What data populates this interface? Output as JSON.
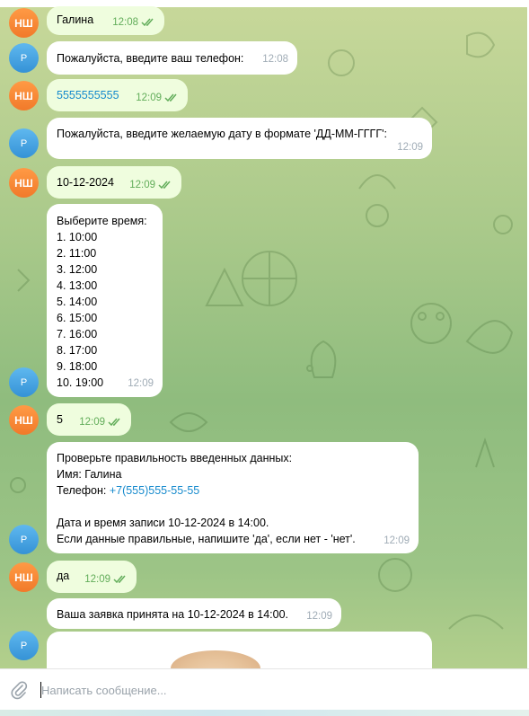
{
  "avatars": {
    "user_initials": "НШ",
    "bot_initials": "Р"
  },
  "messages": [
    {
      "text": "Галина",
      "time": "12:08"
    },
    {
      "text": "Пожалуйста, введите ваш телефон:",
      "time": "12:08"
    },
    {
      "text": "5555555555",
      "time": "12:09"
    },
    {
      "text": "Пожалуйста, введите желаемую дату в формате 'ДД-ММ-ГГГГ':",
      "time": "12:09"
    },
    {
      "text": "10-12-2024",
      "time": "12:09"
    },
    {
      "text": "Выберите время:\n1. 10:00\n2. 11:00\n3. 12:00\n4. 13:00\n5. 14:00\n6. 15:00\n7. 16:00\n8. 17:00\n9. 18:00\n10. 19:00",
      "time": "12:09"
    },
    {
      "text": "5",
      "time": "12:09"
    },
    {
      "line1": "Проверьте правильность введенных данных:",
      "line2": "Имя: Галина",
      "phone_label": "Телефон: ",
      "phone_link": "+7(555)555-55-55",
      "line4": "Дата и время записи 10-12-2024 в 14:00.",
      "line5": "Если данные правильные, напишите 'да', если нет - 'нет'.",
      "time": "12:09"
    },
    {
      "text": "да",
      "time": "12:09"
    },
    {
      "text": "Ваша заявка принята на 10-12-2024 в 14:00.",
      "time": "12:09"
    }
  ],
  "compose": {
    "placeholder": "Написать сообщение...",
    "value": ""
  },
  "colors": {
    "outgoing_bubble": "#effdde",
    "incoming_bubble": "#ffffff",
    "read_check": "#62ad5a",
    "link": "#168acd"
  }
}
